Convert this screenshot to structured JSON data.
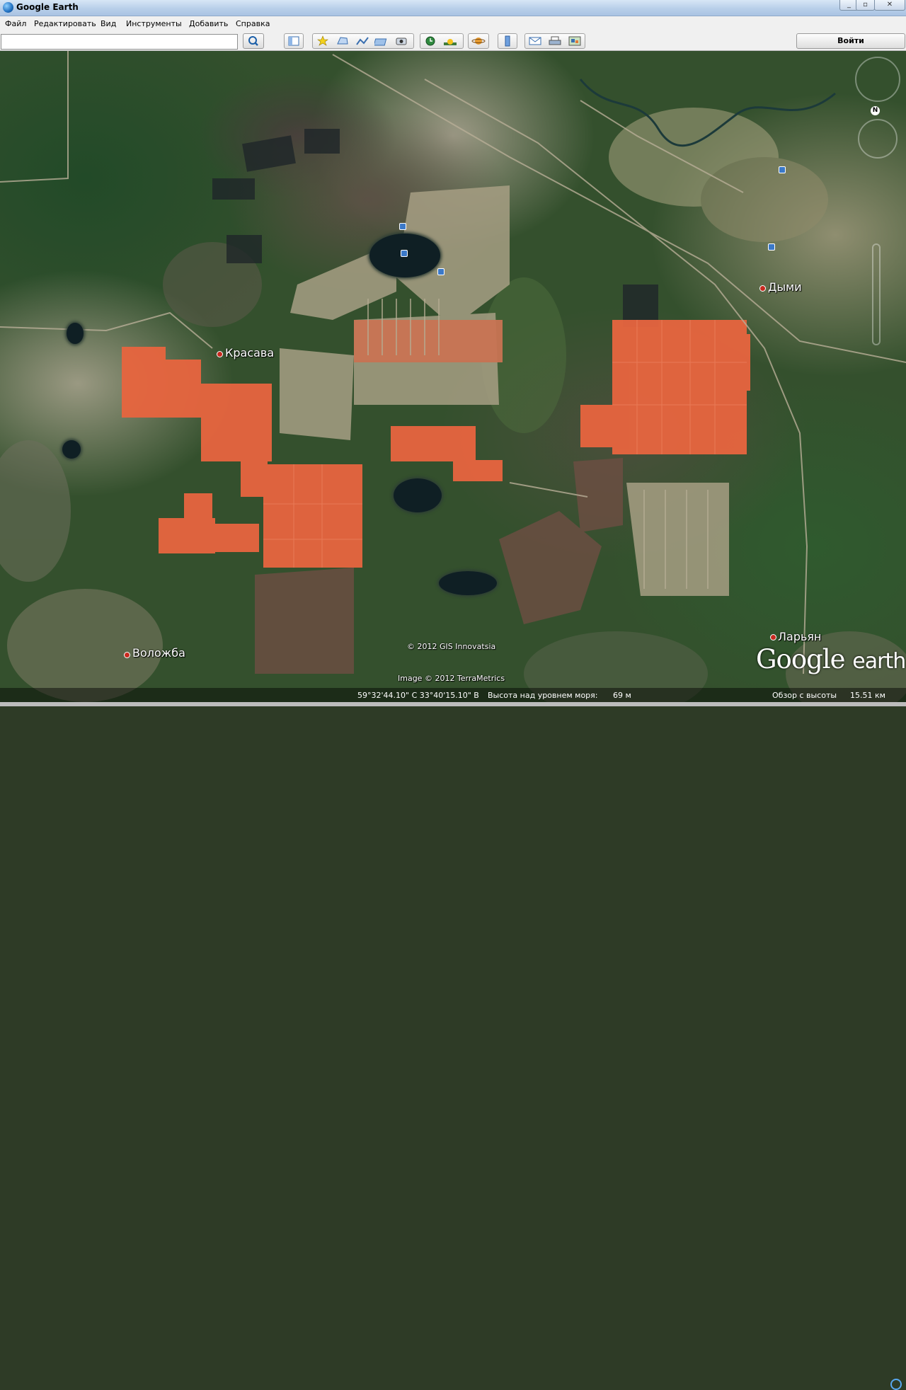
{
  "window": {
    "title": "Google Earth",
    "controls": [
      "_",
      "▫",
      "✕"
    ]
  },
  "menu": [
    "Файл",
    "Редактировать",
    "Вид",
    "Инструменты",
    "Добавить",
    "Справка"
  ],
  "search": {
    "value": "",
    "placeholder": ""
  },
  "toolbar": {
    "tools": [
      "sidebar-icon",
      "placemark-icon",
      "polygon-icon",
      "path-icon",
      "overlay-icon",
      "tour-icon",
      "history-icon",
      "sun-icon",
      "planets-icon",
      "ruler-icon",
      "email-icon",
      "print-icon",
      "map-view-icon"
    ],
    "login_label": "Войти"
  },
  "map": {
    "places": [
      {
        "name": "Красава"
      },
      {
        "name": "Дыми"
      },
      {
        "name": "Воложба"
      },
      {
        "name": "Ларьян"
      }
    ],
    "compass_label": "N",
    "copyright_1": "© 2012 GIS Innovatsia",
    "copyright_2": "Image © 2012 TerraMetrics",
    "logo_google": "Google",
    "logo_earth": "earth"
  },
  "status": {
    "coords": "59°32'44.10\" С  33°40'15.10\" В",
    "elevation_label": "Высота над уровнем моря:",
    "elevation_value": "69 м",
    "eye_alt_label": "Обзор с высоты",
    "eye_alt_value": "15.51 км"
  },
  "colors": {
    "field_orange": "#e8653f",
    "forest": "#2c4a2a",
    "lake": "#0f1f24",
    "titlebar": "#b8cfe9"
  }
}
